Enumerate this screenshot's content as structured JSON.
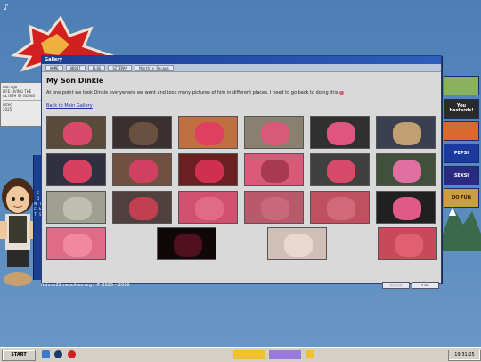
{
  "window": {
    "title": "Gallery",
    "nav": [
      "HOME",
      "ABOUT",
      "BLOG",
      "SITEMAP",
      "Monthly Recaps"
    ],
    "heading": "My Son Dinkle",
    "description": "At one point we took Dinkle everywhere we went and took many pictures of him in different places. I need to go back to doing this",
    "back_link": "Back to Main Gallery"
  },
  "thumbnails": [
    {
      "bg": "#5a4a3a",
      "blob": "#d94a6a"
    },
    {
      "bg": "#3b3030",
      "blob": "#6a5040"
    },
    {
      "bg": "#c07040",
      "blob": "#e04060"
    },
    {
      "bg": "#8a8070",
      "blob": "#d85a7a"
    },
    {
      "bg": "#303030",
      "blob": "#e05580"
    },
    {
      "bg": "#3a4050",
      "blob": "#c0a070"
    },
    {
      "bg": "#303040",
      "blob": "#d84060"
    },
    {
      "bg": "#705040",
      "blob": "#d04060"
    },
    {
      "bg": "#6a2020",
      "blob": "#d03050"
    },
    {
      "bg": "#d85a78",
      "blob": "#a83a50"
    },
    {
      "bg": "#404040",
      "blob": "#d84a6a"
    },
    {
      "bg": "#40503a",
      "blob": "#e070a0"
    },
    {
      "bg": "#a0a090",
      "blob": "#c0c0b0"
    },
    {
      "bg": "#504040",
      "blob": "#c04050"
    },
    {
      "bg": "#d05070",
      "blob": "#e06a88"
    },
    {
      "bg": "#b85a6a",
      "blob": "#c86878"
    },
    {
      "bg": "#c05060",
      "blob": "#d06a78"
    },
    {
      "bg": "#202020",
      "blob": "#e05a88"
    },
    {
      "bg": "#e06a88",
      "blob": "#f088a0"
    },
    {
      "bg": "#100808",
      "blob": "#501020"
    },
    {
      "bg": "#d0c0b8",
      "blob": "#e8d8d0"
    },
    {
      "bg": "#c84a5a",
      "blob": "#e06070"
    }
  ],
  "footer": {
    "link": "fishcar22.neocities.org / © 2025 – 2026",
    "badges": [
      "▢▢▢▢▢",
      "2 day"
    ]
  },
  "old_window": {
    "lines": [
      "dan ago",
      "LIFE LIVING THE",
      "AL ISTH IM GOING",
      "",
      "isited",
      "2025"
    ]
  },
  "sidebar_strip_text": "C O N T E N T S",
  "ads": [
    {
      "label": "",
      "bg": "#8ab060"
    },
    {
      "label": "You bastards!",
      "bg": "#2a2a2a"
    },
    {
      "label": "",
      "bg": "#d86a30"
    },
    {
      "label": "PEPSI",
      "bg": "#1a3aa0"
    },
    {
      "label": "SEXSI",
      "bg": "#2a2a80"
    },
    {
      "label": "",
      "bg": "#b02020"
    },
    {
      "label": "DO FUN",
      "bg": "#c8a040"
    }
  ],
  "taskbar": {
    "start": "START",
    "clock": "19:31:25"
  },
  "colors": {
    "titlebar": "#1c3f93",
    "window_bg": "#d9d9d9",
    "desktop": "#5a86b6"
  }
}
